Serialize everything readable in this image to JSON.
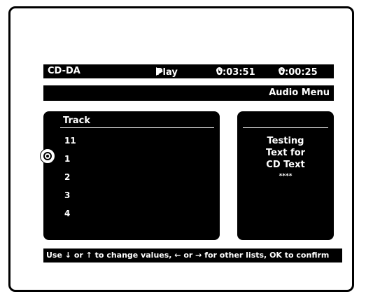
{
  "status": {
    "format": "CD-DA",
    "play_state": "Play",
    "total_time": "0:03:51",
    "elapsed_time": "0:00:25"
  },
  "menu": {
    "title": "Audio Menu"
  },
  "track_list": {
    "header": "Track",
    "items": [
      "11",
      "1",
      "2",
      "3",
      "4"
    ],
    "current_index": 1
  },
  "cd_text": {
    "lines": [
      "Testing",
      "Text for",
      "CD Text"
    ],
    "more": "****"
  },
  "help": {
    "text": "Use ↓ or ↑ to change values, ← or → for other lists, OK to confirm"
  }
}
